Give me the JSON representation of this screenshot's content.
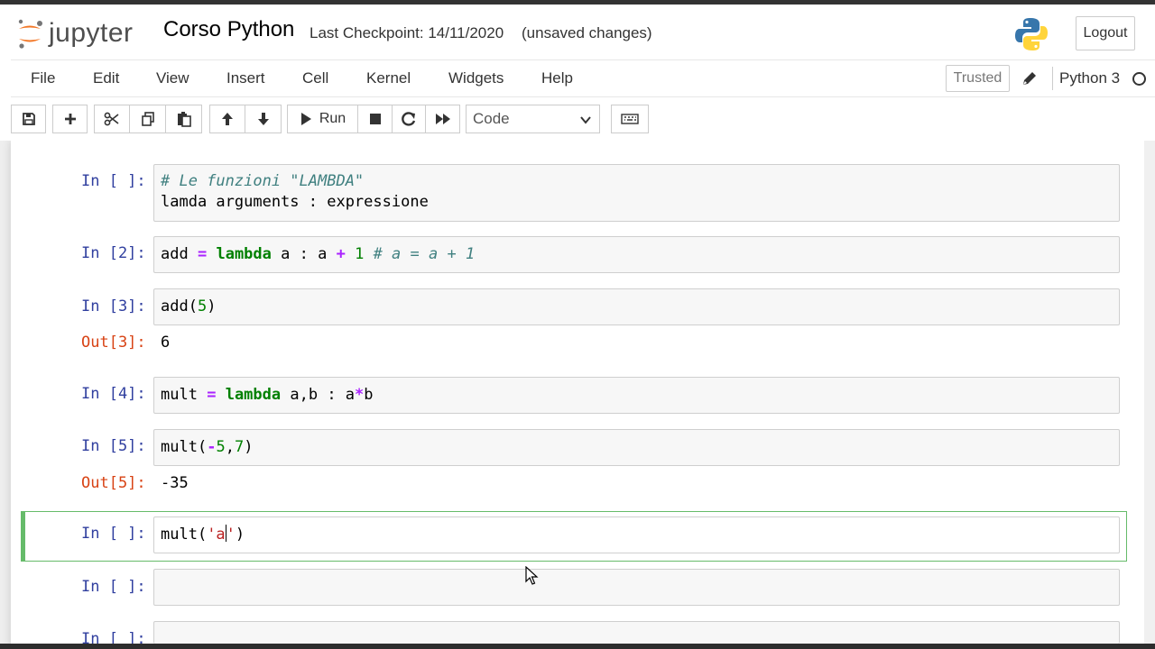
{
  "header": {
    "logo_text": "jupyter",
    "notebook_title": "Corso Python",
    "checkpoint": "Last Checkpoint: 14/11/2020",
    "status": "(unsaved changes)",
    "logout_label": "Logout"
  },
  "menu": {
    "items": [
      "File",
      "Edit",
      "View",
      "Insert",
      "Cell",
      "Kernel",
      "Widgets",
      "Help"
    ],
    "trusted_label": "Trusted",
    "kernel_name": "Python 3"
  },
  "toolbar": {
    "run_label": "Run",
    "cell_type": "Code",
    "icons": [
      "save-icon",
      "plus-icon",
      "cut-icon",
      "copy-icon",
      "paste-icon",
      "arrow-up-icon",
      "arrow-down-icon",
      "run-icon",
      "stop-icon",
      "restart-icon",
      "fast-forward-icon",
      "keyboard-icon"
    ]
  },
  "cells": [
    {
      "prompt": "In [ ]:",
      "line1_comment": "# Le funzioni \"LAMBDA\"",
      "line2": "lamda arguments : expressione"
    },
    {
      "prompt": "In [2]:",
      "v1": "add",
      "op1": "=",
      "kw": "lambda",
      "v2": "a : a",
      "op2": "+",
      "num": "1",
      "comment": "# a = a + 1"
    },
    {
      "prompt": "In [3]:",
      "v1": "add(",
      "num": "5",
      "v2": ")",
      "out_prompt": "Out[3]:",
      "output": "6"
    },
    {
      "prompt": "In [4]:",
      "v1": "mult",
      "op1": "=",
      "kw": "lambda",
      "v2": "a,b : a",
      "op2": "*",
      "v3": "b"
    },
    {
      "prompt": "In [5]:",
      "v1": "mult(",
      "op1": "-",
      "num1": "5",
      "v2": ",",
      "num2": "7",
      "v3": ")",
      "out_prompt": "Out[5]:",
      "output": "-35"
    },
    {
      "prompt": "In [ ]:",
      "v1": "mult(",
      "str1": "'a",
      "str2": "'",
      "v2": ")"
    },
    {
      "prompt": "In [ ]:"
    },
    {
      "prompt": "In [ ]:"
    }
  ],
  "colors": {
    "in_prompt": "#303f9f",
    "out_prompt": "#d84315",
    "selected_border": "#66bb6a",
    "keyword": "#008000",
    "operator": "#aa22ff",
    "comment": "#408080"
  }
}
